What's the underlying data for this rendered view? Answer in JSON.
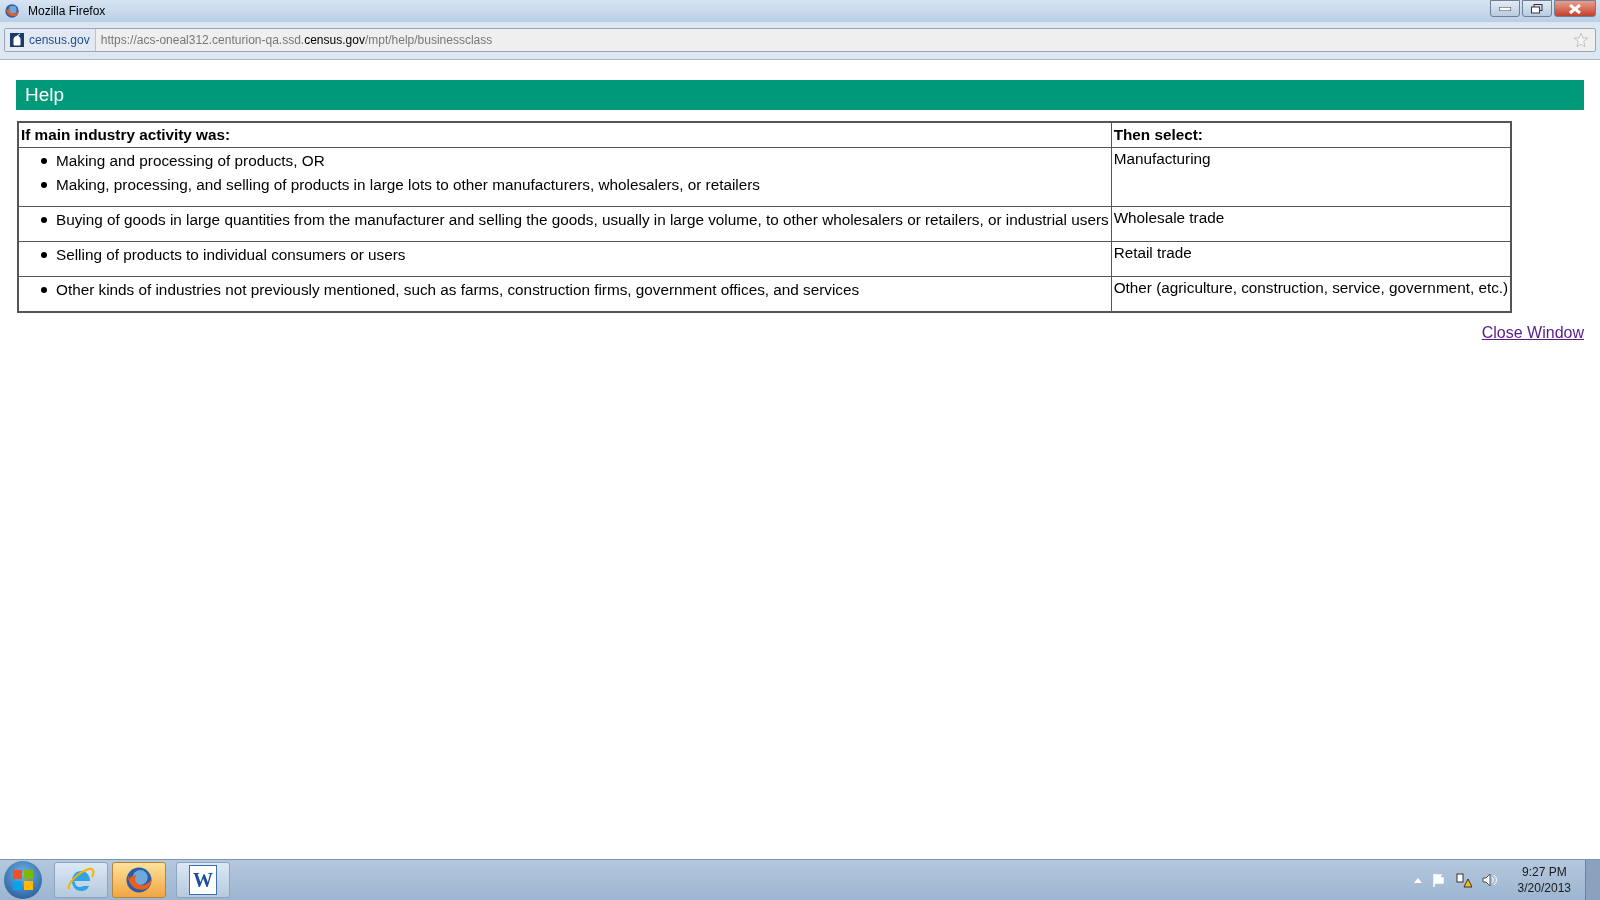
{
  "window": {
    "title": "Mozilla Firefox"
  },
  "address_bar": {
    "site_identity": "census.gov",
    "url_prefix": "https://acs-oneal312.centurion-qa.ssd.",
    "url_domain": "census.gov",
    "url_path": "/mpt/help/businessclass"
  },
  "help": {
    "heading": "Help",
    "columns": [
      "If main industry activity was:",
      "Then select:"
    ],
    "rows": [
      {
        "activities": [
          "Making and processing of products, OR",
          "Making, processing, and selling of products in large lots to other manufacturers, wholesalers, or retailers"
        ],
        "selection": "Manufacturing"
      },
      {
        "activities": [
          "Buying of goods in large quantities from the manufacturer and selling the goods, usually in large volume, to other wholesalers or retailers, or industrial users"
        ],
        "selection": "Wholesale trade"
      },
      {
        "activities": [
          "Selling of products to individual consumers or users"
        ],
        "selection": "Retail trade"
      },
      {
        "activities": [
          "Other kinds of industries not previously mentioned, such as farms, construction firms, government offices, and services"
        ],
        "selection": "Other (agriculture, construction, service, government, etc.)"
      }
    ],
    "close_link": "Close Window"
  },
  "taskbar": {
    "apps": [
      {
        "kind": "ie",
        "selected": false
      },
      {
        "kind": "firefox",
        "selected": true
      },
      {
        "kind": "word",
        "selected": false,
        "letter": "W"
      }
    ],
    "clock": {
      "time": "9:27 PM",
      "date": "3/20/2013"
    }
  }
}
